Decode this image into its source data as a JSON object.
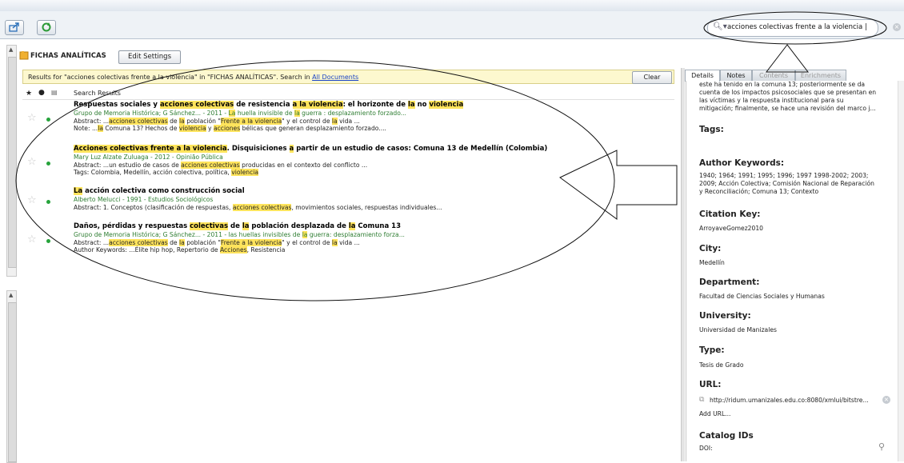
{
  "toolbar": {
    "search_value": "acciones colectivas frente a la violencia |"
  },
  "collection": {
    "name": "FICHAS ANALÍTICAS",
    "edit_label": "Edit Settings"
  },
  "results_bar": {
    "text": "Results for \"acciones colectivas frente a la violencia\" in \"FICHAS ANALÍTICAS\". Search in ",
    "link": "All Documents",
    "clear_label": "Clear"
  },
  "list_header": {
    "label": "Search Results"
  },
  "tabs": [
    "Details",
    "Notes",
    "Contents",
    "Enrichments"
  ],
  "details": {
    "top_lines": [
      "este ha tenido en la comuna 13; posteriormente se da",
      "cuenta de los impactos psicosociales que se presentan en",
      "las víctimas y la respuesta institucional para su",
      "mitigación; finalmente, se hace una revisión del marco j..."
    ],
    "tags_label": "Tags:",
    "kw_label": "Author Keywords:",
    "kw_lines": [
      "1940; 1964; 1991; 1995; 1996; 1997 1998-2002; 2003;",
      "2009; Acción Colectiva; Comisión Nacional de Reparación",
      "y Reconciliación; Comuna 13; Contexto"
    ],
    "citation_label": "Citation Key:",
    "citation": "ArroyaveGomez2010",
    "city_label": "City:",
    "city": "Medellín",
    "dept_label": "Department:",
    "dept": "Facultad de Ciencias Sociales y Humanas",
    "univ_label": "University:",
    "univ": "Universidad de Manizales",
    "type_label": "Type:",
    "type": "Tesis de Grado",
    "url_label": "URL:",
    "url": "http://ridum.umanizales.edu.co:8080/xmlui/bitstre...",
    "add_url": "Add URL...",
    "catalog_label": "Catalog IDs",
    "doi_label": "DOI:"
  },
  "results": [
    {
      "title": [
        [
          "Respuestas sociales y ",
          0
        ],
        [
          "acciones colectivas",
          1
        ],
        [
          " de resistencia ",
          0
        ],
        [
          "a la violencia",
          1
        ],
        [
          ": el horizonte de ",
          0
        ],
        [
          "la",
          1
        ],
        [
          " no ",
          0
        ],
        [
          "violencia",
          1
        ]
      ],
      "lines": [
        {
          "cls": "green",
          "parts": [
            [
              "Grupo de Memoria Histórica; G Sánchez... - 2011 - ",
              0
            ],
            [
              "La",
              1
            ],
            [
              " huella invisible de ",
              0
            ],
            [
              "la",
              1
            ],
            [
              " guerra : desplazamiento forzado...",
              0
            ]
          ]
        },
        {
          "cls": "",
          "parts": [
            [
              "Abstract: ...",
              0
            ],
            [
              "acciones colectivas",
              1
            ],
            [
              " de ",
              0
            ],
            [
              "la",
              1
            ],
            [
              " población \"",
              0
            ],
            [
              "Frente a la violencia",
              1
            ],
            [
              "\" y el control de ",
              0
            ],
            [
              "la",
              1
            ],
            [
              " vida ...",
              0
            ]
          ]
        },
        {
          "cls": "",
          "parts": [
            [
              "Note: ...",
              0
            ],
            [
              "la",
              1
            ],
            [
              " Comuna 13? Hechos de ",
              0
            ],
            [
              "violencia",
              1
            ],
            [
              " y ",
              0
            ],
            [
              "acciones",
              1
            ],
            [
              " bélicas que generan desplazamiento forzado....",
              0
            ]
          ]
        }
      ]
    },
    {
      "title": [
        [
          "Acciones colectivas frente a la violencia",
          1
        ],
        [
          ". Disquisiciones ",
          0
        ],
        [
          "a",
          1
        ],
        [
          " partir de un estudio de casos: Comuna 13 de Medellín (Colombia)",
          0
        ]
      ],
      "lines": [
        {
          "cls": "green",
          "parts": [
            [
              "Mary Luz Alzate Zuluaga - 2012 - Opinião Pública",
              0
            ]
          ]
        },
        {
          "cls": "",
          "parts": [
            [
              "Abstract: ...un estudio de casos de ",
              0
            ],
            [
              "acciones colectivas",
              1
            ],
            [
              " producidas en el contexto del conflicto ...",
              0
            ]
          ]
        },
        {
          "cls": "",
          "parts": [
            [
              "Tags: Colombia, Medellín, acción colectiva, política, ",
              0
            ],
            [
              "violencia",
              1
            ]
          ]
        }
      ]
    },
    {
      "title": [
        [
          "La",
          1
        ],
        [
          " acción colectiva como construcción social",
          0
        ]
      ],
      "lines": [
        {
          "cls": "green",
          "parts": [
            [
              "Alberto Melucci - 1991 - Estudios Sociológicos",
              0
            ]
          ]
        },
        {
          "cls": "",
          "parts": [
            [
              "Abstract: 1. Conceptos (clasificación de respuestas, ",
              0
            ],
            [
              "acciones colectivas",
              1
            ],
            [
              ", movimientos sociales, respuestas individuales...",
              0
            ]
          ]
        }
      ]
    },
    {
      "title": [
        [
          "Daños, pérdidas y respuestas ",
          0
        ],
        [
          "colectivas",
          1
        ],
        [
          " de ",
          0
        ],
        [
          "la",
          1
        ],
        [
          " población desplazada de ",
          0
        ],
        [
          "la",
          1
        ],
        [
          " Comuna 13",
          0
        ]
      ],
      "lines": [
        {
          "cls": "green",
          "parts": [
            [
              "Grupo de Memoria Histórica; G Sánchez... - 2011 - las huellas invisibles de ",
              0
            ],
            [
              "la",
              1
            ],
            [
              " guerra: desplazamiento forza...",
              0
            ]
          ]
        },
        {
          "cls": "",
          "parts": [
            [
              "Abstract: ...",
              0
            ],
            [
              "acciones colectivas",
              1
            ],
            [
              " de ",
              0
            ],
            [
              "la",
              1
            ],
            [
              " población \"",
              0
            ],
            [
              "Frente a la violencia",
              1
            ],
            [
              "\" y el control de ",
              0
            ],
            [
              "la",
              1
            ],
            [
              " vida ...",
              0
            ]
          ]
        },
        {
          "cls": "",
          "parts": [
            [
              "Author Keywords: ...Élite hip hop, Repertorio de ",
              0
            ],
            [
              "Acciones",
              1
            ],
            [
              ", Resistencia",
              0
            ]
          ]
        }
      ]
    }
  ]
}
